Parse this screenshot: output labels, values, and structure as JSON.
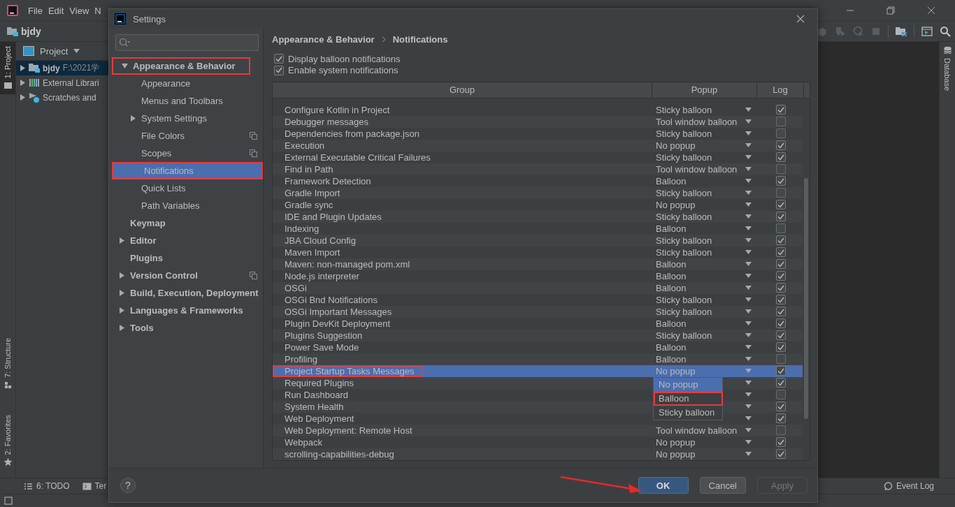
{
  "ide": {
    "menu": [
      "File",
      "Edit",
      "View",
      "N"
    ],
    "project_name": "bjdy",
    "left_tabs": [
      {
        "label": "1: Project",
        "selected": true,
        "kind": "project"
      },
      {
        "label": "7: Structure",
        "selected": false,
        "kind": "structure"
      },
      {
        "label": "2: Favorites",
        "selected": false,
        "kind": "favorites"
      }
    ],
    "project_panel": {
      "title": "Project",
      "tree": [
        {
          "label": "bjdy",
          "path": "F:\\2021学",
          "kind": "module",
          "selected": true
        },
        {
          "label": "External Librari",
          "kind": "libraries",
          "selected": false
        },
        {
          "label": "Scratches and",
          "kind": "scratches",
          "selected": false
        }
      ]
    },
    "right_tabs": [
      {
        "label": "Database"
      }
    ],
    "bottom_tabs": [
      {
        "label": "6: TODO",
        "kind": "todo"
      },
      {
        "label": "Ter",
        "kind": "terminal"
      }
    ],
    "event_log": "Event Log"
  },
  "dialog": {
    "title": "Settings",
    "tree": [
      {
        "label": "Appearance & Behavior",
        "expanded": true,
        "selected": false,
        "highlighted": true,
        "project_level": false,
        "children": [
          {
            "label": "Appearance",
            "selected": false,
            "highlighted": false,
            "project_level": false
          },
          {
            "label": "Menus and Toolbars",
            "selected": false,
            "highlighted": false,
            "project_level": false
          },
          {
            "label": "System Settings",
            "expanded": false,
            "selected": false,
            "highlighted": false,
            "project_level": false
          },
          {
            "label": "File Colors",
            "selected": false,
            "highlighted": false,
            "project_level": true
          },
          {
            "label": "Scopes",
            "selected": false,
            "highlighted": false,
            "project_level": true
          },
          {
            "label": "Notifications",
            "selected": true,
            "highlighted": true,
            "project_level": false
          },
          {
            "label": "Quick Lists",
            "selected": false,
            "highlighted": false,
            "project_level": false
          },
          {
            "label": "Path Variables",
            "selected": false,
            "highlighted": false,
            "project_level": false
          }
        ]
      },
      {
        "label": "Keymap",
        "selected": false,
        "highlighted": false,
        "project_level": false
      },
      {
        "label": "Editor",
        "expanded": false,
        "selected": false,
        "highlighted": false,
        "project_level": false
      },
      {
        "label": "Plugins",
        "selected": false,
        "highlighted": false,
        "project_level": false
      },
      {
        "label": "Version Control",
        "expanded": false,
        "selected": false,
        "highlighted": false,
        "project_level": true
      },
      {
        "label": "Build, Execution, Deployment",
        "expanded": false,
        "selected": false,
        "highlighted": false,
        "project_level": false
      },
      {
        "label": "Languages & Frameworks",
        "expanded": false,
        "selected": false,
        "highlighted": false,
        "project_level": false
      },
      {
        "label": "Tools",
        "expanded": false,
        "selected": false,
        "highlighted": false,
        "project_level": false
      }
    ],
    "breadcrumb": [
      "Appearance & Behavior",
      "Notifications"
    ],
    "options": [
      {
        "label": "Display balloon notifications",
        "checked": true
      },
      {
        "label": "Enable system notifications",
        "checked": true
      }
    ],
    "table": {
      "columns": [
        "Group",
        "Popup",
        "Log"
      ],
      "rows": [
        {
          "group": "Configure Kotlin in Project",
          "popup": "Sticky balloon",
          "log": true,
          "selected": false,
          "highlighted": false
        },
        {
          "group": "Debugger messages",
          "popup": "Tool window balloon",
          "log": false,
          "selected": false,
          "highlighted": false
        },
        {
          "group": "Dependencies from package.json",
          "popup": "Sticky balloon",
          "log": false,
          "selected": false,
          "highlighted": false
        },
        {
          "group": "Execution",
          "popup": "No popup",
          "log": true,
          "selected": false,
          "highlighted": false
        },
        {
          "group": "External Executable Critical Failures",
          "popup": "Sticky balloon",
          "log": true,
          "selected": false,
          "highlighted": false
        },
        {
          "group": "Find in Path",
          "popup": "Tool window balloon",
          "log": false,
          "selected": false,
          "highlighted": false
        },
        {
          "group": "Framework Detection",
          "popup": "Balloon",
          "log": true,
          "selected": false,
          "highlighted": false
        },
        {
          "group": "Gradle Import",
          "popup": "Sticky balloon",
          "log": false,
          "selected": false,
          "highlighted": false
        },
        {
          "group": "Gradle sync",
          "popup": "No popup",
          "log": true,
          "selected": false,
          "highlighted": false
        },
        {
          "group": "IDE and Plugin Updates",
          "popup": "Sticky balloon",
          "log": true,
          "selected": false,
          "highlighted": false
        },
        {
          "group": "Indexing",
          "popup": "Balloon",
          "log": false,
          "selected": false,
          "highlighted": false
        },
        {
          "group": "JBA Cloud Config",
          "popup": "Sticky balloon",
          "log": true,
          "selected": false,
          "highlighted": false
        },
        {
          "group": "Maven Import",
          "popup": "Sticky balloon",
          "log": true,
          "selected": false,
          "highlighted": false
        },
        {
          "group": "Maven: non-managed pom.xml",
          "popup": "Balloon",
          "log": true,
          "selected": false,
          "highlighted": false
        },
        {
          "group": "Node.js interpreter",
          "popup": "Balloon",
          "log": true,
          "selected": false,
          "highlighted": false
        },
        {
          "group": "OSGi",
          "popup": "Balloon",
          "log": true,
          "selected": false,
          "highlighted": false
        },
        {
          "group": "OSGi Bnd Notifications",
          "popup": "Sticky balloon",
          "log": true,
          "selected": false,
          "highlighted": false
        },
        {
          "group": "OSGi Important Messages",
          "popup": "Sticky balloon",
          "log": true,
          "selected": false,
          "highlighted": false
        },
        {
          "group": "Plugin DevKit Deployment",
          "popup": "Balloon",
          "log": true,
          "selected": false,
          "highlighted": false
        },
        {
          "group": "Plugins Suggestion",
          "popup": "Sticky balloon",
          "log": true,
          "selected": false,
          "highlighted": false
        },
        {
          "group": "Power Save Mode",
          "popup": "Balloon",
          "log": true,
          "selected": false,
          "highlighted": false
        },
        {
          "group": "Profiling",
          "popup": "Balloon",
          "log": false,
          "selected": false,
          "highlighted": false
        },
        {
          "group": "Project Startup Tasks Messages",
          "popup": "No popup",
          "log": true,
          "selected": true,
          "highlighted": true
        },
        {
          "group": "Required Plugins",
          "log": true,
          "selected": false,
          "highlighted": false
        },
        {
          "group": "Run Dashboard",
          "log": false,
          "selected": false,
          "highlighted": false
        },
        {
          "group": "System Health",
          "log": true,
          "selected": false,
          "highlighted": false
        },
        {
          "group": "Web Deployment",
          "log": true,
          "selected": false,
          "highlighted": false
        },
        {
          "group": "Web Deployment: Remote Host",
          "popup": "Tool window balloon",
          "log": false,
          "selected": false,
          "highlighted": false
        },
        {
          "group": "Webpack",
          "popup": "No popup",
          "log": true,
          "selected": false,
          "highlighted": false
        },
        {
          "group": "scrolling-capabilities-debug",
          "popup": "No popup",
          "log": true,
          "selected": false,
          "highlighted": false
        }
      ]
    },
    "dropdown": {
      "options": [
        {
          "label": "No popup",
          "selected": true,
          "highlighted": false
        },
        {
          "label": "Balloon",
          "selected": false,
          "highlighted": true
        },
        {
          "label": "Sticky balloon",
          "selected": false,
          "highlighted": false
        }
      ]
    },
    "help": "?",
    "buttons": [
      {
        "label": "OK",
        "kind": "default",
        "disabled": false
      },
      {
        "label": "Cancel",
        "kind": "normal",
        "disabled": false
      },
      {
        "label": "Apply",
        "kind": "normal",
        "disabled": true
      }
    ]
  }
}
